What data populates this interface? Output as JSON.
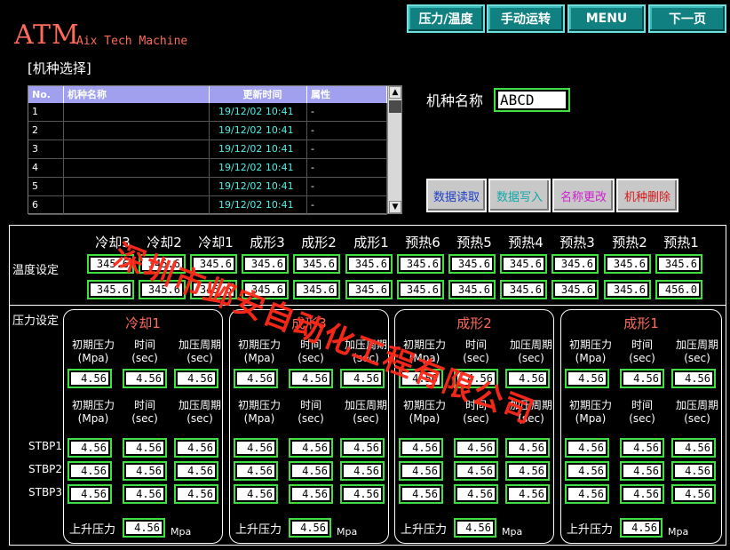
{
  "header": {
    "logo": "ATM",
    "subtitle": "Aix Tech Machine",
    "section_title": "[机种选择]",
    "nav": [
      "压力/温度",
      "手动运转",
      "MENU",
      "下一页"
    ]
  },
  "list": {
    "columns": [
      "No.",
      "机种名称",
      "更新时间",
      "属性"
    ],
    "rows": [
      {
        "no": "1",
        "name": "",
        "updated": "19/12/02  10:41",
        "attr": "-"
      },
      {
        "no": "2",
        "name": "",
        "updated": "19/12/02  10:41",
        "attr": "-"
      },
      {
        "no": "3",
        "name": "",
        "updated": "19/12/02  10:41",
        "attr": "-"
      },
      {
        "no": "4",
        "name": "",
        "updated": "19/12/02  10:41",
        "attr": "-"
      },
      {
        "no": "5",
        "name": "",
        "updated": "19/12/02  10:41",
        "attr": "-"
      },
      {
        "no": "6",
        "name": "",
        "updated": "19/12/02  10:41",
        "attr": "-"
      }
    ]
  },
  "model": {
    "label": "机种名称",
    "value": "ABCD"
  },
  "actions": [
    {
      "label": "数据读取",
      "color": "#1f3fc8"
    },
    {
      "label": "数据写入",
      "color": "#12a8a8"
    },
    {
      "label": "名称更改",
      "color": "#d020d0"
    },
    {
      "label": "机种删除",
      "color": "#d81818"
    }
  ],
  "temperature": {
    "label": "温度设定",
    "zones": [
      "冷却3",
      "冷却2",
      "冷却1",
      "成形3",
      "成形2",
      "成形1",
      "预热6",
      "预热5",
      "预热4",
      "预热3",
      "预热2",
      "预热1"
    ],
    "row1": [
      "345.6",
      "345.6",
      "345.6",
      "345.6",
      "345.6",
      "345.6",
      "345.6",
      "345.6",
      "345.6",
      "345.6",
      "345.6",
      "345.6"
    ],
    "row2": [
      "345.6",
      "345.6",
      "345.6",
      "345.6",
      "345.6",
      "345.6",
      "345.6",
      "345.6",
      "345.6",
      "345.6",
      "345.6",
      "456.0"
    ]
  },
  "pressure": {
    "label": "压力设定",
    "stbp_labels": [
      "STBP1",
      "STBP2",
      "STBP3"
    ],
    "col_headers": [
      "初期压力",
      "时间",
      "加压周期"
    ],
    "col_units": [
      "(Mpa)",
      "(sec)",
      "(sec)"
    ],
    "rise_label": "上升压力",
    "rise_unit": "Mpa",
    "groups": [
      {
        "title": "冷却1",
        "initial": [
          "4.56",
          "4.56",
          "4.56"
        ],
        "stbp": [
          [
            "4.56",
            "4.56",
            "4.56"
          ],
          [
            "4.56",
            "4.56",
            "4.56"
          ],
          [
            "4.56",
            "4.56",
            "4.56"
          ]
        ],
        "rise": "4.56"
      },
      {
        "title": "成形3",
        "initial": [
          "4.56",
          "4.56",
          "4.56"
        ],
        "stbp": [
          [
            "4.56",
            "4.56",
            "4.56"
          ],
          [
            "4.56",
            "4.56",
            "4.56"
          ],
          [
            "4.56",
            "4.56",
            "4.56"
          ]
        ],
        "rise": "4.56"
      },
      {
        "title": "成形2",
        "initial": [
          "4.56",
          "4.56",
          "4.56"
        ],
        "stbp": [
          [
            "4.56",
            "4.56",
            "4.56"
          ],
          [
            "4.56",
            "4.56",
            "4.56"
          ],
          [
            "4.56",
            "4.56",
            "4.56"
          ]
        ],
        "rise": "4.56"
      },
      {
        "title": "成形1",
        "initial": [
          "4.56",
          "4.56",
          "4.56"
        ],
        "stbp": [
          [
            "4.56",
            "4.56",
            "4.56"
          ],
          [
            "4.56",
            "4.56",
            "4.56"
          ],
          [
            "4.56",
            "4.56",
            "4.56"
          ]
        ],
        "rise": "4.56"
      }
    ]
  },
  "watermark": "深圳市邺安自动化工程有限公司",
  "colors": {
    "field_border": "#40e040",
    "nav_bg": "#108080",
    "accent_red": "#ff6a5a",
    "list_header": "#a0a0ee"
  }
}
